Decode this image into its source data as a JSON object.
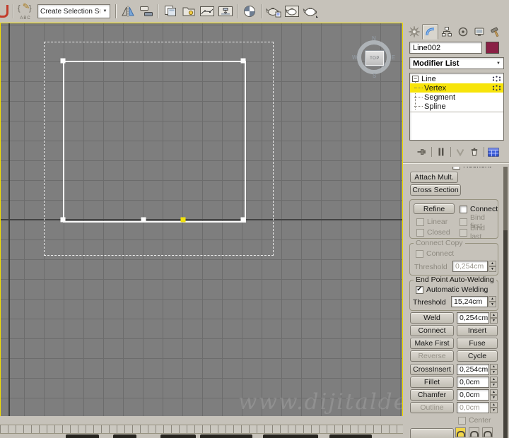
{
  "toolbar": {
    "selection_set_value": "Create Selection Se",
    "abc_label": "ABC"
  },
  "glyphs": {
    "check": "✓",
    "spinner_up": "▲",
    "spinner_down": "▼",
    "combo_arrow": "▼",
    "expand_minus": "−",
    "pencil": "✎",
    "brace_open": "{",
    "brace_close": "}"
  },
  "viewport": {
    "viewcube_face": "TOP",
    "compass": {
      "n": "N",
      "e": "E",
      "s": "S",
      "w": "W"
    },
    "watermark": "www.dijitalde"
  },
  "panel": {
    "object_name": "Line002",
    "object_color": "#8a2045",
    "modifier_list": "Modifier List",
    "stack": {
      "root": "Line",
      "items": [
        "Vertex",
        "Segment",
        "Spline"
      ]
    },
    "rollout": {
      "reorient": "Reorient",
      "attach_mult": "Attach Mult.",
      "cross_section": "Cross Section",
      "refine": "Refine",
      "connect_cb": "Connect",
      "linear": "Linear",
      "closed": "Closed",
      "bind_first": "Bind first",
      "bind_last": "Bind last",
      "connect_copy": {
        "title": "Connect Copy",
        "connect": "Connect",
        "threshold_label": "Threshold",
        "threshold_value": "0,254cm"
      },
      "auto_weld": {
        "title": "End Point Auto-Welding",
        "checkbox": "Automatic Welding",
        "threshold_label": "Threshold",
        "threshold_value": "15,24cm"
      },
      "weld": "Weld",
      "weld_value": "0,254cm",
      "connect": "Connect",
      "insert": "Insert",
      "make_first": "Make First",
      "fuse": "Fuse",
      "reverse": "Reverse",
      "cycle": "Cycle",
      "cross_insert": "CrossInsert",
      "cross_insert_value": "0,254cm",
      "fillet": "Fillet",
      "fillet_value": "0,0cm",
      "chamfer": "Chamfer",
      "chamfer_value": "0,0cm",
      "outline": "Outline",
      "outline_value": "0,0cm",
      "center": "Center"
    }
  }
}
